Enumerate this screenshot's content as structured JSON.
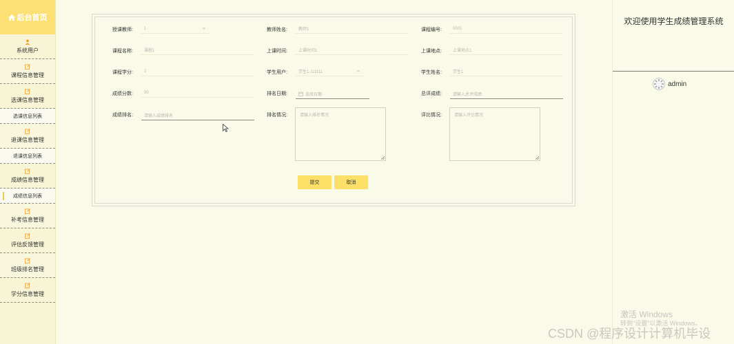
{
  "sidebar": {
    "header": "后台首页",
    "items": [
      {
        "label": "系统用户",
        "icon": "user-icon"
      },
      {
        "label": "课程信息管理",
        "icon": "edit-icon"
      },
      {
        "label": "选课信息管理",
        "icon": "edit-icon"
      },
      {
        "label": "选课信息列表",
        "sub": true
      },
      {
        "label": "退课信息管理",
        "icon": "edit-icon"
      },
      {
        "label": "退课信息列表",
        "sub": true
      },
      {
        "label": "成绩信息管理",
        "icon": "edit-icon"
      },
      {
        "label": "成绩信息列表",
        "sub": true,
        "active": true
      },
      {
        "label": "补考信息管理",
        "icon": "edit-icon"
      },
      {
        "label": "评估反馈管理",
        "icon": "edit-icon"
      },
      {
        "label": "班级排名管理",
        "icon": "edit-icon"
      },
      {
        "label": "学分信息管理",
        "icon": "edit-icon"
      }
    ]
  },
  "form": {
    "teacher_label": "授课教师:",
    "teacher_value": "1",
    "teacher_name_label": "教师姓名:",
    "teacher_name_value": "教师1",
    "course_no_label": "课程编号:",
    "course_no_value": "0001",
    "course_name_label": "课程名称:",
    "course_name_value": "课程1",
    "class_time_label": "上课时间:",
    "class_time_value": "上课时间1",
    "class_place_label": "上课地点:",
    "class_place_value": "上课地点1",
    "credit_label": "课程学分:",
    "credit_value": "2",
    "student_user_label": "学生用户:",
    "student_user_value": "学生1-111111",
    "student_name_label": "学生姓名:",
    "student_name_value": "学生1",
    "score_label": "成绩分数:",
    "score_value": "90",
    "rank_date_label": "排名日期:",
    "rank_date_placeholder": "选择日期",
    "total_score_label": "总评成绩:",
    "total_score_placeholder": "请输入总评成绩",
    "score_rank_label": "成绩排名:",
    "score_rank_placeholder": "请输入成绩排名",
    "rank_status_label": "排名情况:",
    "rank_status_placeholder": "请输入排名情况",
    "review_label": "评比情况:",
    "review_placeholder": "请输入评比情况",
    "submit": "提交",
    "cancel": "取消"
  },
  "header": {
    "welcome": "欢迎使用学生成绩管理系统",
    "username": "admin"
  },
  "overlay": {
    "activate_title": "激活 Windows",
    "activate_sub": "转到\"设置\"以激活 Windows。",
    "watermark": "CSDN @程序设计计算机毕设"
  },
  "colors": {
    "accent": "#fde073",
    "button": "#fde068",
    "background": "#fafae9"
  }
}
